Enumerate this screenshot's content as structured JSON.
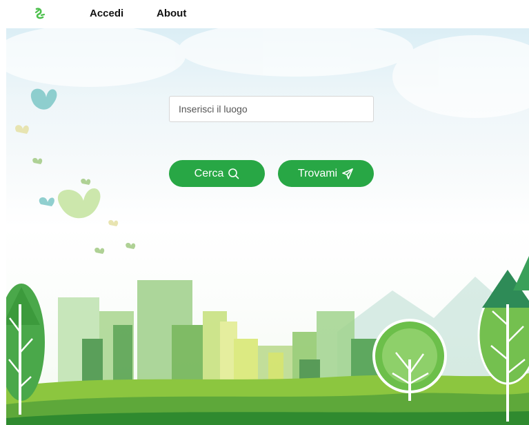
{
  "navbar": {
    "logo_icon": "leaf-logo-icon",
    "links": [
      {
        "label": "Accedi"
      },
      {
        "label": "About"
      }
    ]
  },
  "search": {
    "placeholder": "Inserisci il luogo",
    "value": ""
  },
  "buttons": {
    "cerca": {
      "label": "Cerca",
      "icon": "search-icon"
    },
    "trovami": {
      "label": "Trovami",
      "icon": "send-icon"
    }
  },
  "colors": {
    "brand_green": "#28a745",
    "logo_green": "#4cc04c"
  }
}
